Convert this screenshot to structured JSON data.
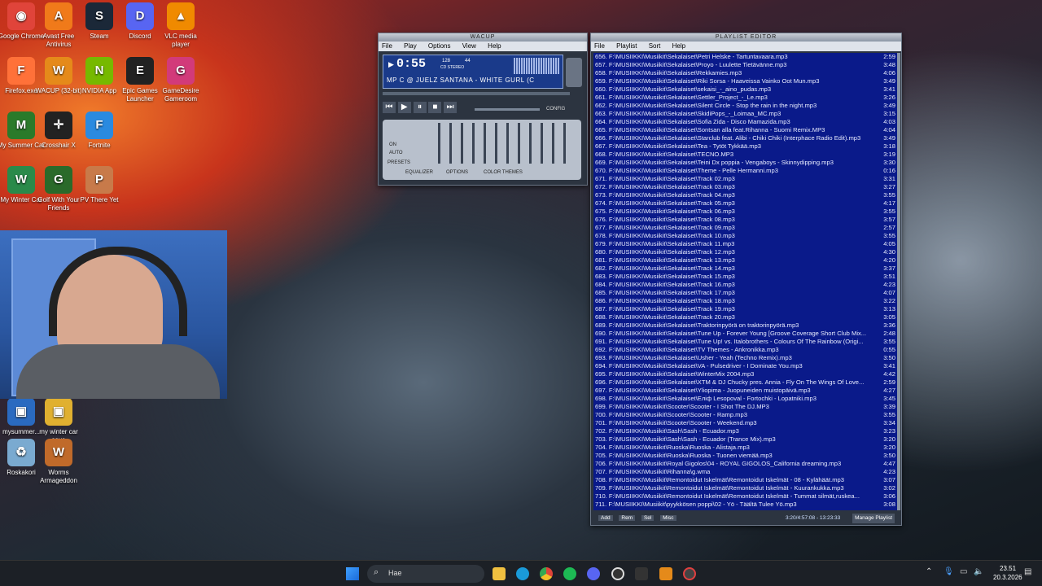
{
  "desktop_icons": [
    {
      "label": "Google Chrome",
      "color": "#e0443a",
      "glyph": "◉"
    },
    {
      "label": "Avast Free Antivirus",
      "color": "#f07a1a",
      "glyph": "A"
    },
    {
      "label": "Steam",
      "color": "#1b2838",
      "glyph": "S"
    },
    {
      "label": "Discord",
      "color": "#5865f2",
      "glyph": "D"
    },
    {
      "label": "VLC media player",
      "color": "#f08a00",
      "glyph": "▲"
    },
    {
      "label": "Firefox.exe",
      "color": "#ff7139",
      "glyph": "F"
    },
    {
      "label": "WACUP (32-bit)",
      "color": "#e58a1a",
      "glyph": "W"
    },
    {
      "label": "NVIDIA App",
      "color": "#76b900",
      "glyph": "N"
    },
    {
      "label": "Epic Games Launcher",
      "color": "#222222",
      "glyph": "E"
    },
    {
      "label": "GameDesire Gameroom",
      "color": "#d23a7a",
      "glyph": "G"
    },
    {
      "label": "My Summer Car",
      "color": "#2a7a2a",
      "glyph": "M"
    },
    {
      "label": "Crosshair X",
      "color": "#222222",
      "glyph": "✛"
    },
    {
      "label": "Fortnite",
      "color": "#2a8ae0",
      "glyph": "F"
    },
    {
      "label": "My Winter Car",
      "color": "#2a8a4a",
      "glyph": "W"
    },
    {
      "label": "Golf With Your Friends",
      "color": "#2a6a2a",
      "glyph": "G"
    },
    {
      "label": "PV There Yet",
      "color": "#c87a4a",
      "glyph": "P"
    },
    {
      "label": "mysummer...",
      "color": "#2a6ac0",
      "glyph": "▣"
    },
    {
      "label": "my winter car save",
      "color": "#e0b030",
      "glyph": "▣"
    },
    {
      "label": "Roskakori",
      "color": "#7aaad0",
      "glyph": "♻"
    },
    {
      "label": "Worms Armageddon",
      "color": "#c06a2a",
      "glyph": "W"
    }
  ],
  "winamp": {
    "title": "WACUP",
    "menu": [
      "File",
      "Play",
      "Options",
      "View",
      "Help"
    ],
    "time": "0:55",
    "kbps": "128",
    "khz": "44",
    "mode_label": "CD STEREO",
    "track_text": "MP C @ JUELZ SANTANA - WHITE GURL (C",
    "eq_tabs": [
      "EQUALIZER",
      "OPTIONS",
      "COLOR THEMES"
    ],
    "eq_buttons": [
      "ON",
      "AUTO",
      "PRESETS"
    ],
    "config_label": "CONFIG"
  },
  "playlist": {
    "title": "PLAYLIST EDITOR",
    "menu": [
      "File",
      "Playlist",
      "Sort",
      "Help"
    ],
    "footer_buttons": [
      "Add",
      "Rem",
      "Sel",
      "Misc"
    ],
    "footer_info": "3:20/4:57:08 - 13:23:33",
    "manage_label": "Manage Playlist",
    "rows": [
      {
        "t": "656. F:\\MUSIIKKI\\Musiikit\\Sekalaiset\\Petri Helske - Tartuntavaara.mp3",
        "d": "2:59"
      },
      {
        "t": "657. F:\\MUSIIKKI\\Musiikit\\Sekalaiset\\Proyo - Luulette Tietävänne.mp3",
        "d": "3:48"
      },
      {
        "t": "658. F:\\MUSIIKKI\\Musiikit\\Sekalaiset\\Rekkamies.mp3",
        "d": "4:06"
      },
      {
        "t": "659. F:\\MUSIIKKI\\Musiikit\\Sekalaiset\\Riki Sorsa - Haaveissa Vainko Oot Mun.mp3",
        "d": "3:49"
      },
      {
        "t": "660. F:\\MUSIIKKI\\Musiikit\\Sekalaiset\\sekaisi_-_aino_pudas.mp3",
        "d": "3:41"
      },
      {
        "t": "661. F:\\MUSIIKKI\\Musiikit\\Sekalaiset\\Settler_Project_-_Le.mp3",
        "d": "3:26"
      },
      {
        "t": "662. F:\\MUSIIKKI\\Musiikit\\Sekalaiset\\Silent Circle - Stop the rain in the night.mp3",
        "d": "3:49"
      },
      {
        "t": "663. F:\\MUSIIKKI\\Musiikit\\Sekalaiset\\SkidiPops_-_Loimaa_MC.mp3",
        "d": "3:15"
      },
      {
        "t": "664. F:\\MUSIIKKI\\Musiikit\\Sekalaiset\\Sofia Zida - Disco Mamazida.mp3",
        "d": "4:03"
      },
      {
        "t": "665. F:\\MUSIIKKI\\Musiikit\\Sekalaiset\\Sontsan alla feat.Rihanna - Suomi Remix.MP3",
        "d": "4:04"
      },
      {
        "t": "666. F:\\MUSIIKKI\\Musiikit\\Sekalaiset\\Starclub feat. Alibi - Chiki Chiki (Interphace Radio Edit).mp3",
        "d": "3:49"
      },
      {
        "t": "667. F:\\MUSIIKKI\\Musiikit\\Sekalaiset\\Tea - Tytöt Tykkää.mp3",
        "d": "3:18"
      },
      {
        "t": "668. F:\\MUSIIKKI\\Musiikit\\Sekalaiset\\TECNO.MP3",
        "d": "3:19"
      },
      {
        "t": "669. F:\\MUSIIKKI\\Musiikit\\Sekalaiset\\Teini Dx poppia - Vengaboys - Skinnydipping.mp3",
        "d": "3:30"
      },
      {
        "t": "670. F:\\MUSIIKKI\\Musiikit\\Sekalaiset\\Theme - Pelle Hermanni.mp3",
        "d": "0:16"
      },
      {
        "t": "671. F:\\MUSIIKKI\\Musiikit\\Sekalaiset\\Track 02.mp3",
        "d": "3:31"
      },
      {
        "t": "672. F:\\MUSIIKKI\\Musiikit\\Sekalaiset\\Track 03.mp3",
        "d": "3:27"
      },
      {
        "t": "673. F:\\MUSIIKKI\\Musiikit\\Sekalaiset\\Track 04.mp3",
        "d": "3:55"
      },
      {
        "t": "674. F:\\MUSIIKKI\\Musiikit\\Sekalaiset\\Track 05.mp3",
        "d": "4:17"
      },
      {
        "t": "675. F:\\MUSIIKKI\\Musiikit\\Sekalaiset\\Track 06.mp3",
        "d": "3:55"
      },
      {
        "t": "676. F:\\MUSIIKKI\\Musiikit\\Sekalaiset\\Track 08.mp3",
        "d": "3:57"
      },
      {
        "t": "677. F:\\MUSIIKKI\\Musiikit\\Sekalaiset\\Track 09.mp3",
        "d": "2:57"
      },
      {
        "t": "678. F:\\MUSIIKKI\\Musiikit\\Sekalaiset\\Track 10.mp3",
        "d": "3:55"
      },
      {
        "t": "679. F:\\MUSIIKKI\\Musiikit\\Sekalaiset\\Track 11.mp3",
        "d": "4:05"
      },
      {
        "t": "680. F:\\MUSIIKKI\\Musiikit\\Sekalaiset\\Track 12.mp3",
        "d": "4:30"
      },
      {
        "t": "681. F:\\MUSIIKKI\\Musiikit\\Sekalaiset\\Track 13.mp3",
        "d": "4:20"
      },
      {
        "t": "682. F:\\MUSIIKKI\\Musiikit\\Sekalaiset\\Track 14.mp3",
        "d": "3:37"
      },
      {
        "t": "683. F:\\MUSIIKKI\\Musiikit\\Sekalaiset\\Track 15.mp3",
        "d": "3:51"
      },
      {
        "t": "684. F:\\MUSIIKKI\\Musiikit\\Sekalaiset\\Track 16.mp3",
        "d": "4:23"
      },
      {
        "t": "685. F:\\MUSIIKKI\\Musiikit\\Sekalaiset\\Track 17.mp3",
        "d": "4:07"
      },
      {
        "t": "686. F:\\MUSIIKKI\\Musiikit\\Sekalaiset\\Track 18.mp3",
        "d": "3:22"
      },
      {
        "t": "687. F:\\MUSIIKKI\\Musiikit\\Sekalaiset\\Track 19.mp3",
        "d": "3:13"
      },
      {
        "t": "688. F:\\MUSIIKKI\\Musiikit\\Sekalaiset\\Track 20.mp3",
        "d": "3:05"
      },
      {
        "t": "689. F:\\MUSIIKKI\\Musiikit\\Sekalaiset\\Traktorinpyörä on traktorinpyörä.mp3",
        "d": "3:36"
      },
      {
        "t": "690. F:\\MUSIIKKI\\Musiikit\\Sekalaiset\\Tune Up - Forever Young [Groove Coverage Short Club Mix...",
        "d": "2:48"
      },
      {
        "t": "691. F:\\MUSIIKKI\\Musiikit\\Sekalaiset\\Tune Up! vs. Italobrothers - Colours Of The Rainbow (Origi...",
        "d": "3:55"
      },
      {
        "t": "692. F:\\MUSIIKKI\\Musiikit\\Sekalaiset\\TV Themes - Ankronikka.mp3",
        "d": "0:55"
      },
      {
        "t": "693. F:\\MUSIIKKI\\Musiikit\\Sekalaiset\\Usher - Yeah (Techno Remix).mp3",
        "d": "3:50"
      },
      {
        "t": "694. F:\\MUSIIKKI\\Musiikit\\Sekalaiset\\VA - Pulsedriver - I Dominate You.mp3",
        "d": "3:41"
      },
      {
        "t": "695. F:\\MUSIIKKI\\Musiikit\\Sekalaiset\\WinterMix 2004.mp3",
        "d": "4:42"
      },
      {
        "t": "696. F:\\MUSIIKKI\\Musiikit\\Sekalaiset\\XTM & DJ Chucky pres. Annia - Fly On The Wings Of Love...",
        "d": "2:59"
      },
      {
        "t": "697. F:\\MUSIIKKI\\Musiikit\\Sekalaiset\\Yliopima - Juopuneiden muistopäivä.mp3",
        "d": "4:27"
      },
      {
        "t": "698. F:\\MUSIIKKI\\Musiikit\\Sekalaiset\\Еліф Lesopoval - Fortochki - Lopatniki.mp3",
        "d": "3:45"
      },
      {
        "t": "699. F:\\MUSIIKKI\\Musiikit\\Scooter\\Scooter - I Shot The DJ.MP3",
        "d": "3:39"
      },
      {
        "t": "700. F:\\MUSIIKKI\\Musiikit\\Scooter\\Scooter - Ramp.mp3",
        "d": "3:55"
      },
      {
        "t": "701. F:\\MUSIIKKI\\Musiikit\\Scooter\\Scooter - Weekend.mp3",
        "d": "3:34"
      },
      {
        "t": "702. F:\\MUSIIKKI\\Musiikit\\Sash\\Sash - Ecuador.mp3",
        "d": "3:23"
      },
      {
        "t": "703. F:\\MUSIIKKI\\Musiikit\\Sash\\Sash - Ecuador (Trance Mix).mp3",
        "d": "3:20"
      },
      {
        "t": "704. F:\\MUSIIKKI\\Musiikit\\Ruoska\\Ruoska - Alistaja.mp3",
        "d": "3:20"
      },
      {
        "t": "705. F:\\MUSIIKKI\\Musiikit\\Ruoska\\Ruoska - Tuonen viemää.mp3",
        "d": "3:50"
      },
      {
        "t": "706. F:\\MUSIIKKI\\Musiikit\\Royal Gigolos\\04 - ROYAL GIGOLOS_California dreaming.mp3",
        "d": "4:47"
      },
      {
        "t": "707. F:\\MUSIIKKI\\Musiikit\\Rihanna\\g.wma",
        "d": "4:23"
      },
      {
        "t": "708. F:\\MUSIIKKI\\Musiikit\\Remontoidut Iskelmät\\Remontoidut Iskelmät - 08 - Kylähäät.mp3",
        "d": "3:07"
      },
      {
        "t": "709. F:\\MUSIIKKI\\Musiikit\\Remontoidut Iskelmät\\Remontoidut Iskelmät - Kuurankukka.mp3",
        "d": "3:02"
      },
      {
        "t": "710. F:\\MUSIIKKI\\Musiikit\\Remontoidut Iskelmät\\Remontoidut Iskelmät - Tummat silmät,ruskea...",
        "d": "3:06"
      },
      {
        "t": "711. F:\\MUSIIKKI\\Musiikit\\pyykkösen poppi\\02 - Yö - Täältä Tulee Yö.mp3",
        "d": "3:08"
      }
    ]
  },
  "taskbar": {
    "search_placeholder": "Hae",
    "time": "23.51",
    "date": "20.3.2026"
  }
}
